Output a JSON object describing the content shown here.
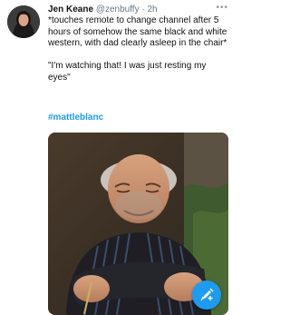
{
  "tweet": {
    "author_name": "Jen Keane",
    "author_handle": "@zenbuffy",
    "separator": "·",
    "time": "2h",
    "more_icon": "more-horizontal-icon",
    "text": "*touches remote to change channel after 5 hours of somehow the same black and white western, with dad clearly asleep in the chair*\n\n\"I'm watching that! I was just resting my eyes\"",
    "hashtag": "#mattleblanc"
  },
  "compose_button": {
    "icon": "compose-tweet-icon"
  },
  "colors": {
    "link": "#1d9bf0",
    "text": "#111111",
    "secondary": "#6b7785",
    "accent": "#1d9bf0"
  }
}
